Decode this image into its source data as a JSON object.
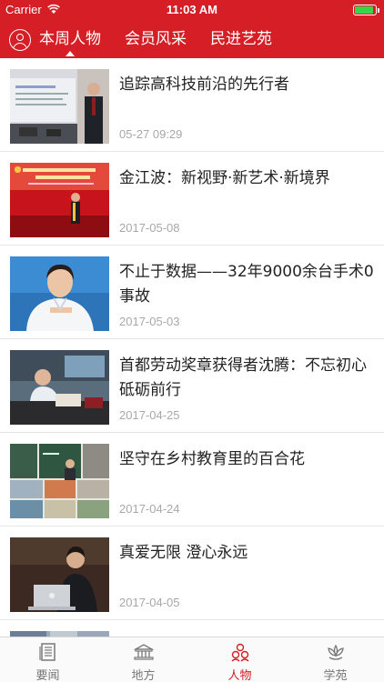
{
  "status_bar": {
    "carrier": "Carrier",
    "time": "11:03 AM",
    "battery_level": 0.9,
    "battery_color": "#3cd24b"
  },
  "header": {
    "background_color": "#d51e26",
    "user_icon": "user-circle-icon",
    "tabs": [
      {
        "label": "本周人物",
        "selected": true
      },
      {
        "label": "会员风采",
        "selected": false
      },
      {
        "label": "民进艺苑",
        "selected": false
      }
    ]
  },
  "articles": [
    {
      "title": "追踪高科技前沿的先行者",
      "date": "05-27 09:29"
    },
    {
      "title": "金江波：新视野·新艺术·新境界",
      "date": "2017-05-08"
    },
    {
      "title": "不止于数据——32年9000余台手术0事故",
      "date": "2017-05-03"
    },
    {
      "title": "首都劳动奖章获得者沈腾：不忘初心 砥砺前行",
      "date": "2017-04-25"
    },
    {
      "title": "坚守在乡村教育里的百合花",
      "date": "2017-04-24"
    },
    {
      "title": "真爱无限 澄心永远",
      "date": "2017-04-05"
    }
  ],
  "tab_bar": {
    "active_color": "#d51e26",
    "items": [
      {
        "label": "要闻",
        "icon": "newspaper-icon",
        "active": false
      },
      {
        "label": "地方",
        "icon": "building-icon",
        "active": false
      },
      {
        "label": "人物",
        "icon": "people-icon",
        "active": true
      },
      {
        "label": "学苑",
        "icon": "lotus-icon",
        "active": false
      }
    ]
  }
}
